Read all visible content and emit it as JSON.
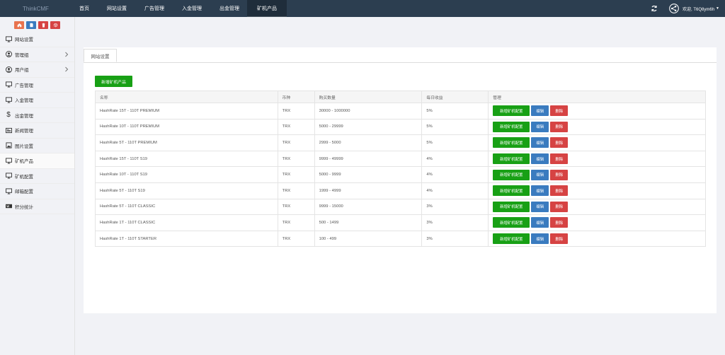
{
  "brand": "ThinkCMF",
  "nav": [
    "首页",
    "网站设置",
    "广告管理",
    "入金管理",
    "出金管理",
    "矿机产品"
  ],
  "user": {
    "greeting": "欢迎, T6Q8ym6h"
  },
  "colors": {
    "topbar": "#2c3e50",
    "green": "#18a015",
    "blue": "#3a7bbf",
    "red": "#d64343"
  },
  "quick_buttons": [
    {
      "icon": "home-icon",
      "color": "#e8734e"
    },
    {
      "icon": "document-icon",
      "color": "#3a7bbf"
    },
    {
      "icon": "trash-icon",
      "color": "#d64343"
    },
    {
      "icon": "gear-icon",
      "color": "#d64343"
    }
  ],
  "sidebar": [
    {
      "label": "网站设置",
      "icon": "monitor-icon"
    },
    {
      "label": "管理组",
      "icon": "user-circle-icon",
      "arrow": true
    },
    {
      "label": "用户组",
      "icon": "user-circle-icon",
      "arrow": true
    },
    {
      "label": "广告管理",
      "icon": "monitor-icon"
    },
    {
      "label": "入金管理",
      "icon": "monitor-icon"
    },
    {
      "label": "出金管理",
      "icon": "dollar-icon"
    },
    {
      "label": "新闻管理",
      "icon": "news-icon"
    },
    {
      "label": "图片设置",
      "icon": "image-icon"
    },
    {
      "label": "矿机产品",
      "icon": "monitor-icon",
      "active": true
    },
    {
      "label": "矿机配置",
      "icon": "monitor-icon"
    },
    {
      "label": "邮箱配置",
      "icon": "monitor-icon"
    },
    {
      "label": "积分统计",
      "icon": "web-icon"
    }
  ],
  "tab": "网站设置",
  "add_button": "新增矿机产品",
  "table": {
    "headers": [
      "名称",
      "币种",
      "购买数量",
      "每日收益",
      "管理"
    ],
    "rows": [
      [
        "HashRate 15T - 110T PREMIUM",
        "TRX",
        "30000 - 1000000",
        "5%"
      ],
      [
        "HashRate 10T - 110T PREMIUM",
        "TRX",
        "5000 - 29999",
        "5%"
      ],
      [
        "HashRate 5T - 110T PREMIUM",
        "TRX",
        "2999 - 5000",
        "5%"
      ],
      [
        "HashRate 15T - 110T S19",
        "TRX",
        "9999 - 49999",
        "4%"
      ],
      [
        "HashRate 10T - 110T S19",
        "TRX",
        "5000 - 9999",
        "4%"
      ],
      [
        "HashRate 5T - 110T S19",
        "TRX",
        "1999 - 4999",
        "4%"
      ],
      [
        "HashRate 5T - 110T CLASSIC",
        "TRX",
        "9999 - 15000",
        "3%"
      ],
      [
        "HashRate 1T - 110T CLASSIC",
        "TRX",
        "500 - 1499",
        "3%"
      ],
      [
        "HashRate 1T - 110T STARTER",
        "TRX",
        "100 - 499",
        "3%"
      ]
    ],
    "ops": {
      "config": "新增矿机配置",
      "edit": "编辑",
      "delete": "删除"
    }
  }
}
